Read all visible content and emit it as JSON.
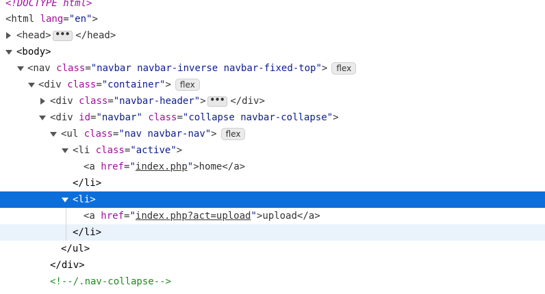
{
  "rows": [
    {
      "text": "<!DOCTYPE html>"
    },
    {
      "tag_open": "<html ",
      "attr": "lang",
      "eq": "=",
      "val": "\"en\"",
      "tag_close": ">"
    },
    {
      "tag_open": "<head>",
      "ellipsis": "•••",
      "tag_end": "</head>"
    },
    {
      "tag": "<body>"
    },
    {
      "tag_open": "<nav ",
      "attr": "class",
      "eq": "=",
      "val": "\"navbar navbar-inverse navbar-fixed-top\"",
      "tag_close": ">",
      "badge": "flex"
    },
    {
      "tag_open": "<div ",
      "attr": "class",
      "eq": "=",
      "val": "\"container\"",
      "tag_close": ">",
      "badge": "flex"
    },
    {
      "tag_open": "<div ",
      "attr": "class",
      "eq": "=",
      "val": "\"navbar-header\"",
      "tag_close": ">",
      "ellipsis": "•••",
      "tag_end": "</div>"
    },
    {
      "tag_open": "<div ",
      "attr1": "id",
      "eq1": "=",
      "val1": "\"navbar\"",
      "sp": " ",
      "attr2": "class",
      "eq2": "=",
      "val2": "\"collapse navbar-collapse\"",
      "tag_close": ">"
    },
    {
      "tag_open": "<ul ",
      "attr": "class",
      "eq": "=",
      "val": "\"nav navbar-nav\"",
      "tag_close": ">",
      "badge": "flex"
    },
    {
      "tag_open": "<li ",
      "attr": "class",
      "eq": "=",
      "val": "\"active\"",
      "tag_close": ">"
    },
    {
      "tag_open": "<a ",
      "attr": "href",
      "eq": "=",
      "q1": "\"",
      "link": "index.php",
      "q2": "\"",
      "tag_close": ">",
      "text": "home",
      "tag_end": "</a>"
    },
    {
      "tag": "</li>"
    },
    {
      "tag": "<li>"
    },
    {
      "tag_open": "<a ",
      "attr": "href",
      "eq": "=",
      "q1": "\"",
      "link": "index.php?act=upload",
      "q2": "\"",
      "tag_close": ">",
      "text": "upload",
      "tag_end": "</a>"
    },
    {
      "tag": "</li>"
    },
    {
      "tag": "</ul>"
    },
    {
      "tag": "</div>"
    },
    {
      "comment": "<!--/.nav-collapse-->"
    }
  ],
  "colors": {
    "selection": "#0b6edb",
    "hover": "#eaf3fb",
    "attr": "#a10f9b",
    "value": "#0c1c8c",
    "comment": "#1f8a1f"
  }
}
